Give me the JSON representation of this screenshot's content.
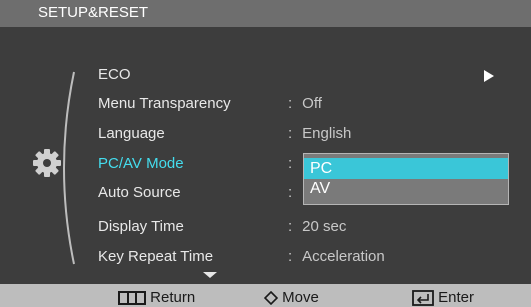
{
  "title": "SETUP&RESET",
  "menu": [
    {
      "label": "ECO",
      "value": ""
    },
    {
      "label": "Menu Transparency",
      "value": "Off"
    },
    {
      "label": "Language",
      "value": "English"
    },
    {
      "label": "PC/AV Mode",
      "value": ""
    },
    {
      "label": "Auto Source",
      "value": ""
    },
    {
      "label": "Display Time",
      "value": "20 sec"
    },
    {
      "label": "Key Repeat Time",
      "value": "Acceleration"
    }
  ],
  "separator": ":",
  "dropdown": {
    "options": [
      "PC",
      "AV"
    ],
    "selected": "PC"
  },
  "bottom": {
    "return": "Return",
    "move": "Move",
    "enter": "Enter"
  },
  "icons": {
    "category": "gear-icon",
    "return": "menu-return-icon",
    "move": "diamond-move-icon",
    "enter": "enter-source-icon",
    "submenu": "play-arrow-icon",
    "more": "scroll-down-icon"
  },
  "colors": {
    "highlight": "#44ddee",
    "selection": "#3ac6d8"
  }
}
